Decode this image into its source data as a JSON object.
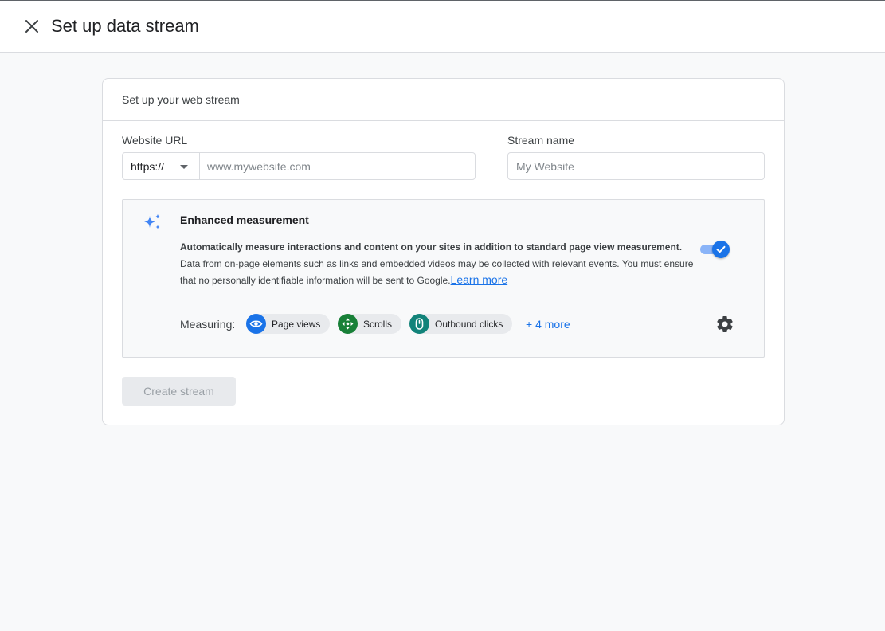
{
  "header": {
    "title": "Set up data stream"
  },
  "card": {
    "header": "Set up your web stream",
    "website_url": {
      "label": "Website URL",
      "protocol": "https://",
      "placeholder": "www.mywebsite.com"
    },
    "stream_name": {
      "label": "Stream name",
      "placeholder": "My Website"
    },
    "enhanced_measurement": {
      "title": "Enhanced measurement",
      "description_bold": "Automatically measure interactions and content on your sites in addition to standard page view measurement.",
      "description": "Data from on-page elements such as links and embedded videos may be collected with relevant events. You must ensure that no personally identifiable information will be sent to Google.",
      "learn_more": "Learn more",
      "enabled": true,
      "measuring_label": "Measuring:",
      "chips": [
        {
          "label": "Page views",
          "icon": "eye-icon",
          "color": "#1a73e8"
        },
        {
          "label": "Scrolls",
          "icon": "scroll-arrows-icon",
          "color": "#188038"
        },
        {
          "label": "Outbound clicks",
          "icon": "mouse-icon",
          "color": "#12837a"
        }
      ],
      "more_link": "+ 4 more"
    },
    "create_button": "Create stream"
  },
  "colors": {
    "accent": "#1a73e8",
    "toggle_track": "#8ab4f8",
    "border": "#dadce0",
    "background": "#f8f9fa"
  }
}
